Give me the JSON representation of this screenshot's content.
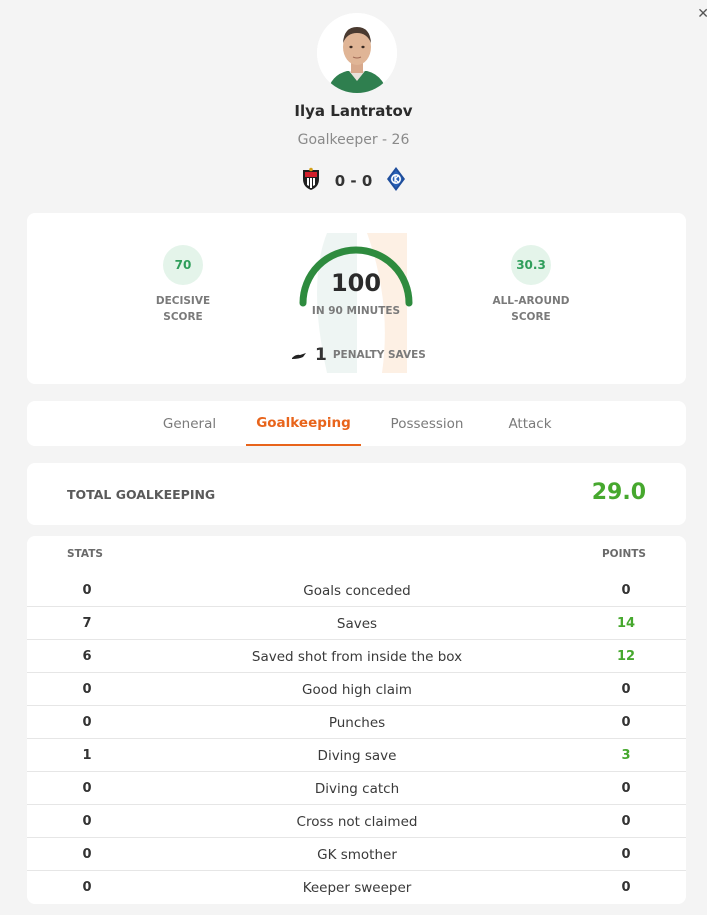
{
  "player": {
    "name": "Ilya Lantratov",
    "subtitle": "Goalkeeper - 26"
  },
  "match": {
    "score": "0 - 0",
    "home_crest": "home-team-crest-icon",
    "away_crest": "away-team-crest-icon"
  },
  "summary": {
    "decisive_score": "70",
    "decisive_label": "DECISIVE\nSCORE",
    "total_score": "100",
    "total_caption": "IN 90 MINUTES",
    "all_around_score": "30.3",
    "all_around_label": "ALL-AROUND\nSCORE",
    "penalty_saves_count": "1",
    "penalty_saves_label": "PENALTY SAVES"
  },
  "tabs": [
    {
      "label": "General",
      "active": false
    },
    {
      "label": "Goalkeeping",
      "active": true
    },
    {
      "label": "Possession",
      "active": false
    },
    {
      "label": "Attack",
      "active": false
    }
  ],
  "total": {
    "label": "TOTAL GOALKEEPING",
    "value": "29.0"
  },
  "table": {
    "headers": {
      "stats": "STATS",
      "points": "POINTS"
    },
    "rows": [
      {
        "stat": "0",
        "label": "Goals conceded",
        "points": "0"
      },
      {
        "stat": "7",
        "label": "Saves",
        "points": "14"
      },
      {
        "stat": "6",
        "label": "Saved shot from inside the box",
        "points": "12"
      },
      {
        "stat": "0",
        "label": "Good high claim",
        "points": "0"
      },
      {
        "stat": "0",
        "label": "Punches",
        "points": "0"
      },
      {
        "stat": "1",
        "label": "Diving save",
        "points": "3"
      },
      {
        "stat": "0",
        "label": "Diving catch",
        "points": "0"
      },
      {
        "stat": "0",
        "label": "Cross not claimed",
        "points": "0"
      },
      {
        "stat": "0",
        "label": "GK smother",
        "points": "0"
      },
      {
        "stat": "0",
        "label": "Keeper sweeper",
        "points": "0"
      }
    ]
  },
  "colors": {
    "accent": "#e8641b",
    "positive": "#46a82e",
    "gauge": "#2e8b3e",
    "badge_bg": "#e4f4ea"
  }
}
